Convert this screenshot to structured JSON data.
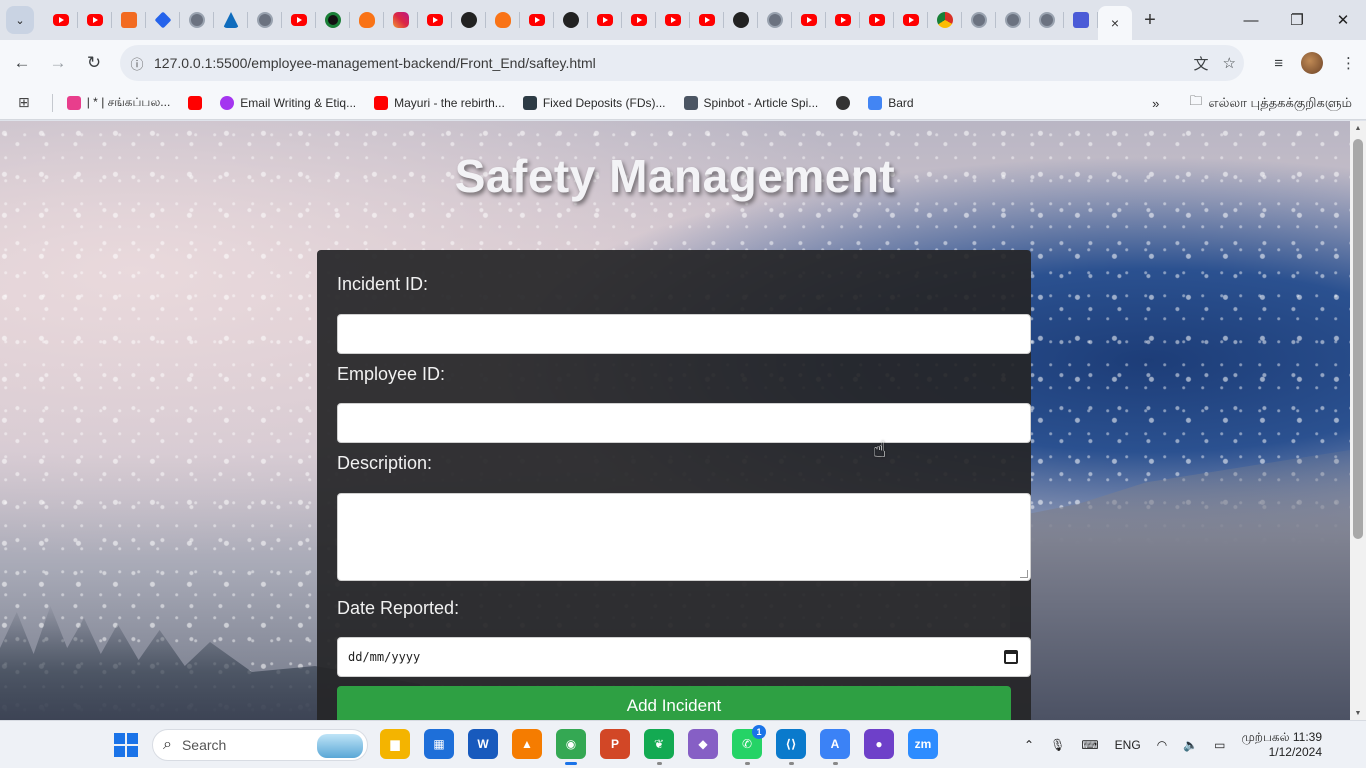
{
  "browser": {
    "active_tab_close": "×",
    "new_tab": "+",
    "window_controls": {
      "minimize": "—",
      "restore": "❐",
      "close": "✕"
    },
    "url": "127.0.0.1:5500/employee-management-backend/Front_End/saftey.html",
    "tab_favicons": [
      "yt",
      "yt",
      "sc",
      "blue",
      "globe",
      "azure",
      "globe",
      "yt",
      "green",
      "fire",
      "ig",
      "yt",
      "gh",
      "fire",
      "yt",
      "gh",
      "yt",
      "yt",
      "yt",
      "yt",
      "gh",
      "globe",
      "yt",
      "yt",
      "yt",
      "yt",
      "chrome",
      "globe",
      "globe",
      "globe",
      "sheet"
    ]
  },
  "bookmarks": {
    "items": [
      {
        "label": "| * | சங்கப்பல...",
        "icon": "bookmark-pink-icon",
        "color": "#e83e8c"
      },
      {
        "label": "",
        "icon": "youtube-icon",
        "color": "#ff0000"
      },
      {
        "label": "Email Writing & Etiq...",
        "icon": "udemy-icon",
        "color": "#a435f0"
      },
      {
        "label": "Mayuri - the rebirth...",
        "icon": "youtube-icon",
        "color": "#ff0000"
      },
      {
        "label": "Fixed Deposits (FDs)...",
        "icon": "ab-icon",
        "color": "#2d3b45"
      },
      {
        "label": "Spinbot - Article Spi...",
        "icon": "spinbot-icon",
        "color": "#4b5563"
      },
      {
        "label": "",
        "icon": "globe-icon",
        "color": "#333333"
      },
      {
        "label": "Bard",
        "icon": "bard-icon",
        "color": "#4285f4"
      }
    ],
    "overflow": "»",
    "all_bookmarks": "எல்லா புத்தகக்குறிகளும்"
  },
  "page": {
    "title": "Safety Management",
    "form": {
      "incident_id_label": "Incident ID:",
      "incident_id_value": "",
      "employee_id_label": "Employee ID:",
      "employee_id_value": "",
      "description_label": "Description:",
      "description_value": "",
      "date_label": "Date Reported:",
      "date_placeholder": "dd/mm/yyyy",
      "submit_label": "Add Incident"
    },
    "colors": {
      "submit": "#2ea043",
      "card": "#262628"
    }
  },
  "taskbar": {
    "search_placeholder": "Search",
    "apps": [
      {
        "name": "file-explorer-icon",
        "color": "#f4b400",
        "glyph": "▆"
      },
      {
        "name": "microsoft-store-icon",
        "color": "#1e6fd9",
        "glyph": "▦"
      },
      {
        "name": "word-icon",
        "color": "#185abd",
        "glyph": "W"
      },
      {
        "name": "vlc-icon",
        "color": "#f57c00",
        "glyph": "▲"
      },
      {
        "name": "chrome-icon",
        "color": "#34a853",
        "glyph": "◉"
      },
      {
        "name": "powerpoint-icon",
        "color": "#d24726",
        "glyph": "P"
      },
      {
        "name": "mongodb-icon",
        "color": "#13aa52",
        "glyph": "❦"
      },
      {
        "name": "visual-studio-icon",
        "color": "#865fc5",
        "glyph": "◆"
      },
      {
        "name": "whatsapp-icon",
        "color": "#25d366",
        "glyph": "✆"
      },
      {
        "name": "vscode-icon",
        "color": "#0a7acc",
        "glyph": "⟨⟩"
      },
      {
        "name": "app-icon",
        "color": "#3b82f6",
        "glyph": "A"
      },
      {
        "name": "github-desktop-icon",
        "color": "#6e40c9",
        "glyph": "●"
      },
      {
        "name": "zoom-icon",
        "color": "#2d8cff",
        "glyph": "zm"
      }
    ],
    "whatsapp_badge": "1",
    "tray": {
      "language": "ENG",
      "time": "முற்பகல் 11:39",
      "date": "1/12/2024"
    }
  }
}
